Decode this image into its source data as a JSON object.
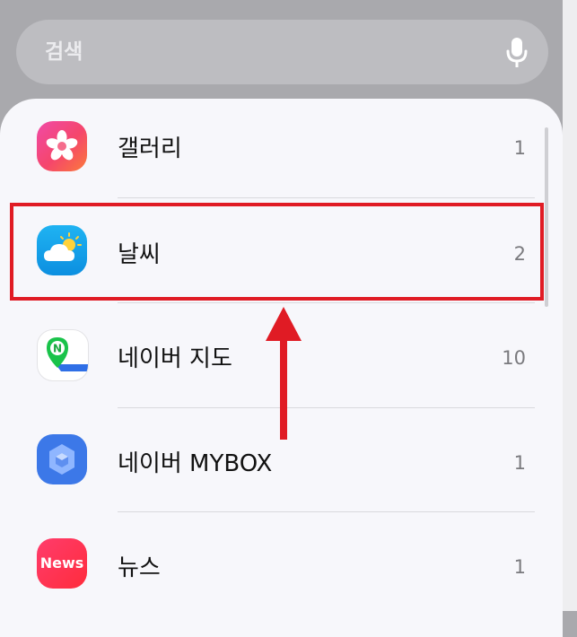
{
  "search": {
    "placeholder": "검색"
  },
  "apps": [
    {
      "name": "갤러리",
      "count": "1",
      "icon": "gallery-icon"
    },
    {
      "name": "날씨",
      "count": "2",
      "icon": "weather-icon"
    },
    {
      "name": "네이버 지도",
      "count": "10",
      "icon": "naver-map-icon"
    },
    {
      "name": "네이버 MYBOX",
      "count": "1",
      "icon": "naver-mybox-icon"
    },
    {
      "name": "뉴스",
      "count": "1",
      "icon": "news-icon",
      "icon_text": "News"
    }
  ],
  "annotation": {
    "highlight_color": "#e01b24",
    "highlighted_item": "날씨"
  }
}
